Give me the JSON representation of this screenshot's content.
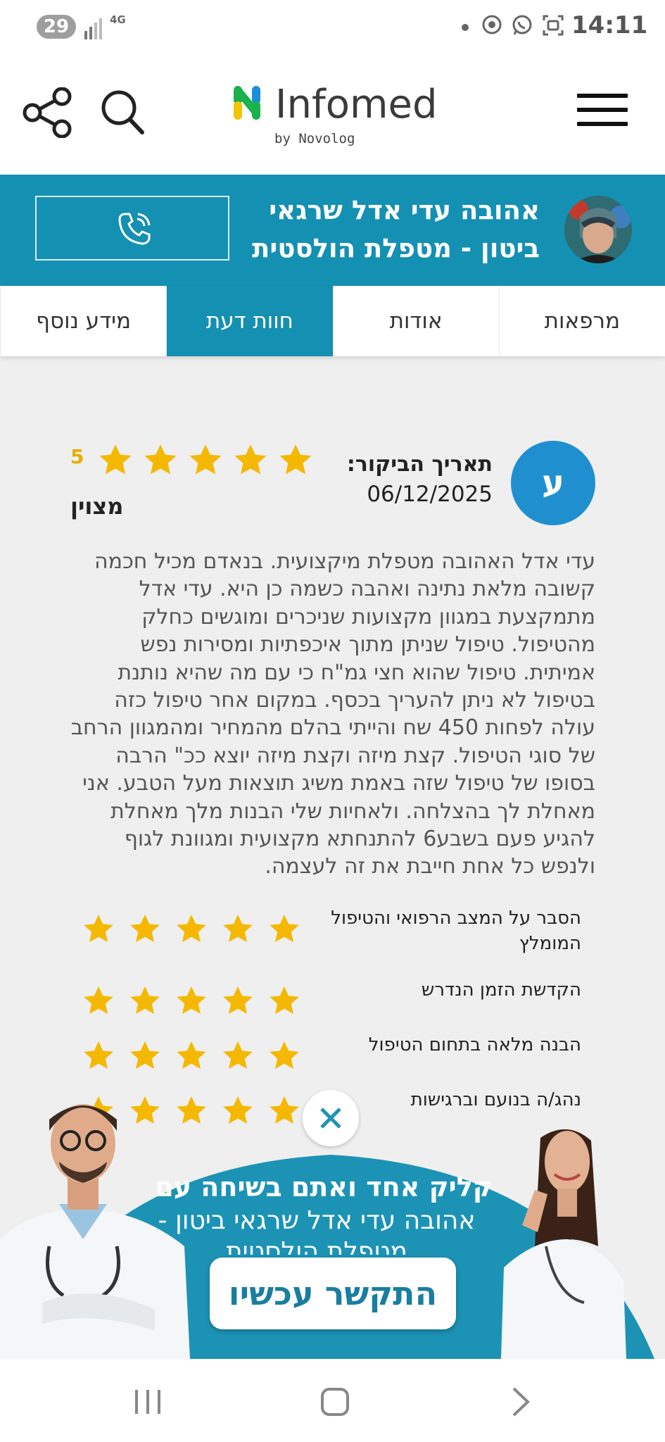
{
  "status_bar": {
    "badge": "29",
    "network": "4G",
    "time": "14:11"
  },
  "header": {
    "logo_text": "Infomed",
    "logo_sub": "by Novolog"
  },
  "therapist": {
    "name": "אהובה עדי אדל שרגאי ביטון - מטפלת הולסטית"
  },
  "tabs": [
    {
      "label": "מרפאות"
    },
    {
      "label": "אודות"
    },
    {
      "label": "חוות דעת"
    },
    {
      "label": "מידע נוסף"
    }
  ],
  "active_tab": "חוות דעת",
  "review": {
    "avatar_letter": "ע",
    "visit_label": "תאריך הביקור:",
    "visit_date": "06/12/2025",
    "rating": "5",
    "rating_word": "מצוין",
    "stars": 5,
    "text": "עדי אדל האהובה מטפלת מיקצועית. בנאדם מכיל חכמה קשובה מלאת נתינה ואהבה כשמה כן היא. עדי אדל מתמקצעת במגוון מקצועות שניכרים ומוגשים כחלק מהטיפול. טיפול שניתן מתוך איכפתיות ומסירות נפש אמיתית. טיפול שהוא חצי גמ\"ח כי עם מה שהיא נותנת בטיפול לא ניתן להעריך בכסף. במקום אחר טיפול כזה עולה לפחות 450 שח והייתי בהלם מהמחיר ומהמגוון הרחב של סוגי הטיפול. קצת מיזה וקצת מיזה יוצא ככ\" הרבה בסופו של טיפול שזה באמת משיג תוצאות מעל הטבע. אני מאחלת לך בהצלחה. ולאחיות שלי הבנות מלך מאחלת להגיע פעם בשבע6 להתנחתא מקצועית ומגוונת לגוף ולנפש כל אחת חייבת את זה לעצמה."
  },
  "criteria": [
    {
      "label": "הסבר על המצב הרפואי והטיפול המומלץ",
      "stars": 5
    },
    {
      "label": "הקדשת הזמן הנדרש",
      "stars": 5
    },
    {
      "label": "הבנה מלאה בתחום הטיפול",
      "stars": 5
    },
    {
      "label": "נהג/ה בנועם וברגישות",
      "stars": 5
    }
  ],
  "promo": {
    "title": "קליק אחד ואתם בשיחה עם",
    "subtitle": "אהובה עדי אדל שרגאי ביטון - מטפלת הולסטית",
    "button": "התקשר עכשיו"
  },
  "colors": {
    "brand_teal": "#1490b2",
    "star_gold": "#f5b800",
    "avatar_blue": "#1f8fd0"
  }
}
